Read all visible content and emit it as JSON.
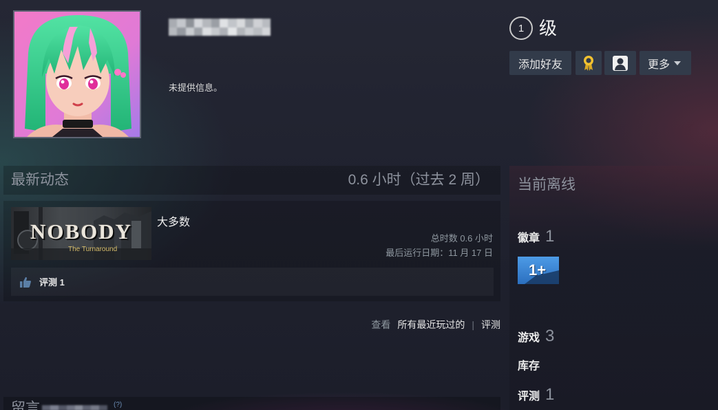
{
  "profile": {
    "summary": "未提供信息。",
    "level_value": "1",
    "level_label": "级"
  },
  "actions": {
    "add_friend": "添加好友",
    "more": "更多"
  },
  "recent_activity": {
    "title": "最新动态",
    "playtime_summary": "0.6 小时（过去 2 周）",
    "games": [
      {
        "capsule_logo": "NOBODY",
        "capsule_subtitle": "The Turnaround",
        "name": "大多数",
        "total_playtime": "总时数 0.6 小时",
        "last_played": "最后运行日期：11 月 17 日",
        "review": "评测 1"
      }
    ],
    "footer_links": {
      "view_prefix": "查看",
      "all_recently_played": "所有最近玩过的",
      "separator": "|",
      "reviews": "评测"
    }
  },
  "comments": {
    "title": "留言",
    "help": "(?)"
  },
  "sidebar": {
    "online_status": "当前离线",
    "badges": {
      "label": "徽章",
      "count": "1",
      "featured_badge_text": "1+"
    },
    "games": {
      "label": "游戏",
      "count": "3"
    },
    "inventory": {
      "label": "库存"
    },
    "reviews": {
      "label": "评测",
      "count": "1"
    }
  },
  "icons": {
    "award": "award-icon",
    "profile": "profile-icon",
    "more": "chevron-down-icon",
    "review": "thumbs-up-icon"
  },
  "colors": {
    "page_background": "#1d1f2b",
    "button_background": "#323b4a",
    "muted_text": "#8d929d",
    "primary_text": "#e6e6e6",
    "award_gold": "#f2c230",
    "badge_blue": "#3a87d8"
  }
}
